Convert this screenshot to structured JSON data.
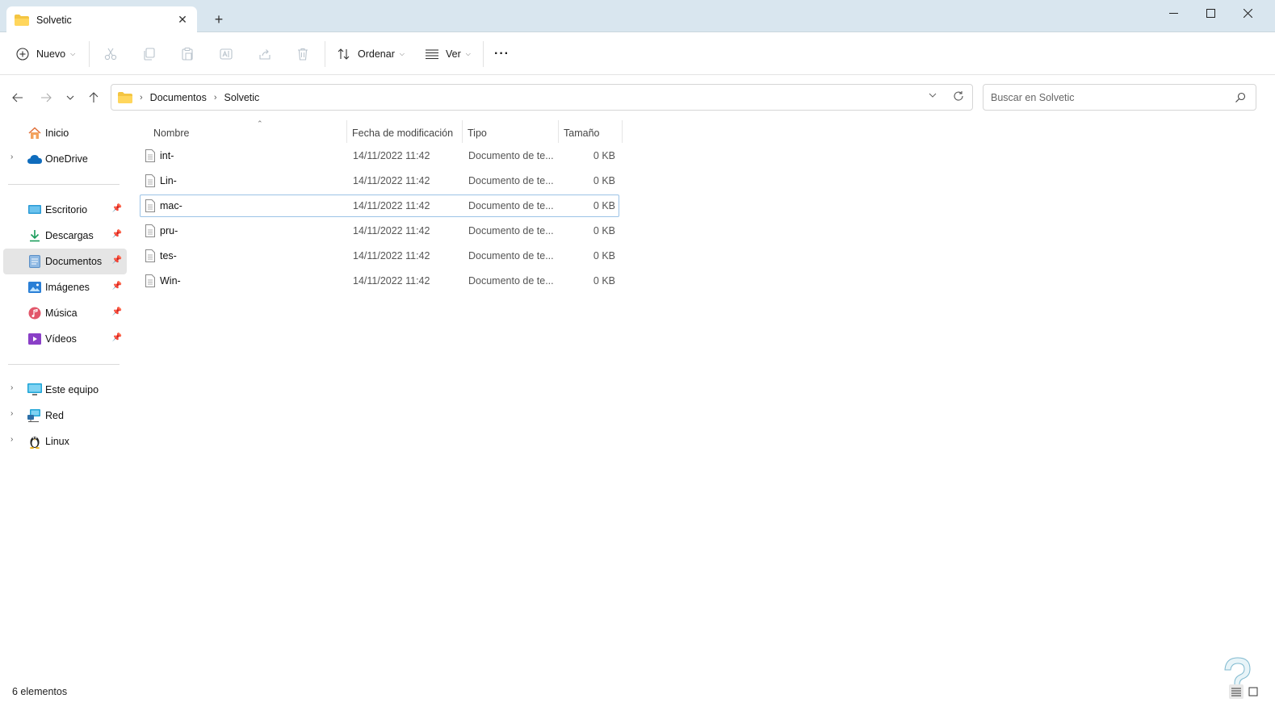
{
  "window": {
    "tab_title": "Solvetic",
    "new_tab": "+",
    "close_tab": "✕"
  },
  "toolbar": {
    "new_label": "Nuevo",
    "sort_label": "Ordenar",
    "view_label": "Ver",
    "more_label": "···"
  },
  "address": {
    "crumbs": [
      "Documentos",
      "Solvetic"
    ]
  },
  "search": {
    "placeholder": "Buscar en Solvetic"
  },
  "sidebar": {
    "items": [
      {
        "label": "Inicio",
        "icon": "home-icon"
      },
      {
        "label": "OneDrive",
        "icon": "cloud-icon"
      },
      {
        "label": "Escritorio",
        "icon": "desktop-icon"
      },
      {
        "label": "Descargas",
        "icon": "download-icon"
      },
      {
        "label": "Documentos",
        "icon": "documents-icon"
      },
      {
        "label": "Imágenes",
        "icon": "pictures-icon"
      },
      {
        "label": "Música",
        "icon": "music-icon"
      },
      {
        "label": "Vídeos",
        "icon": "videos-icon"
      },
      {
        "label": "Este equipo",
        "icon": "computer-icon"
      },
      {
        "label": "Red",
        "icon": "network-icon"
      },
      {
        "label": "Linux",
        "icon": "linux-icon"
      }
    ],
    "selected": "Documentos"
  },
  "columns": {
    "name": "Nombre",
    "date": "Fecha de modificación",
    "type": "Tipo",
    "size": "Tamaño"
  },
  "files": [
    {
      "name": "int-",
      "date": "14/11/2022 11:42",
      "type": "Documento de te...",
      "size": "0 KB"
    },
    {
      "name": "Lin-",
      "date": "14/11/2022 11:42",
      "type": "Documento de te...",
      "size": "0 KB"
    },
    {
      "name": "mac-",
      "date": "14/11/2022 11:42",
      "type": "Documento de te...",
      "size": "0 KB"
    },
    {
      "name": "pru-",
      "date": "14/11/2022 11:42",
      "type": "Documento de te...",
      "size": "0 KB"
    },
    {
      "name": "tes-",
      "date": "14/11/2022 11:42",
      "type": "Documento de te...",
      "size": "0 KB"
    },
    {
      "name": "Win-",
      "date": "14/11/2022 11:42",
      "type": "Documento de te...",
      "size": "0 KB"
    }
  ],
  "focused_file": "mac-",
  "status": {
    "count": "6 elementos"
  },
  "colors": {
    "titlebar": "#d9e6ef",
    "selection": "#e5e5e5",
    "focus_border": "#9cc3e6",
    "folder": "#f4c542"
  }
}
